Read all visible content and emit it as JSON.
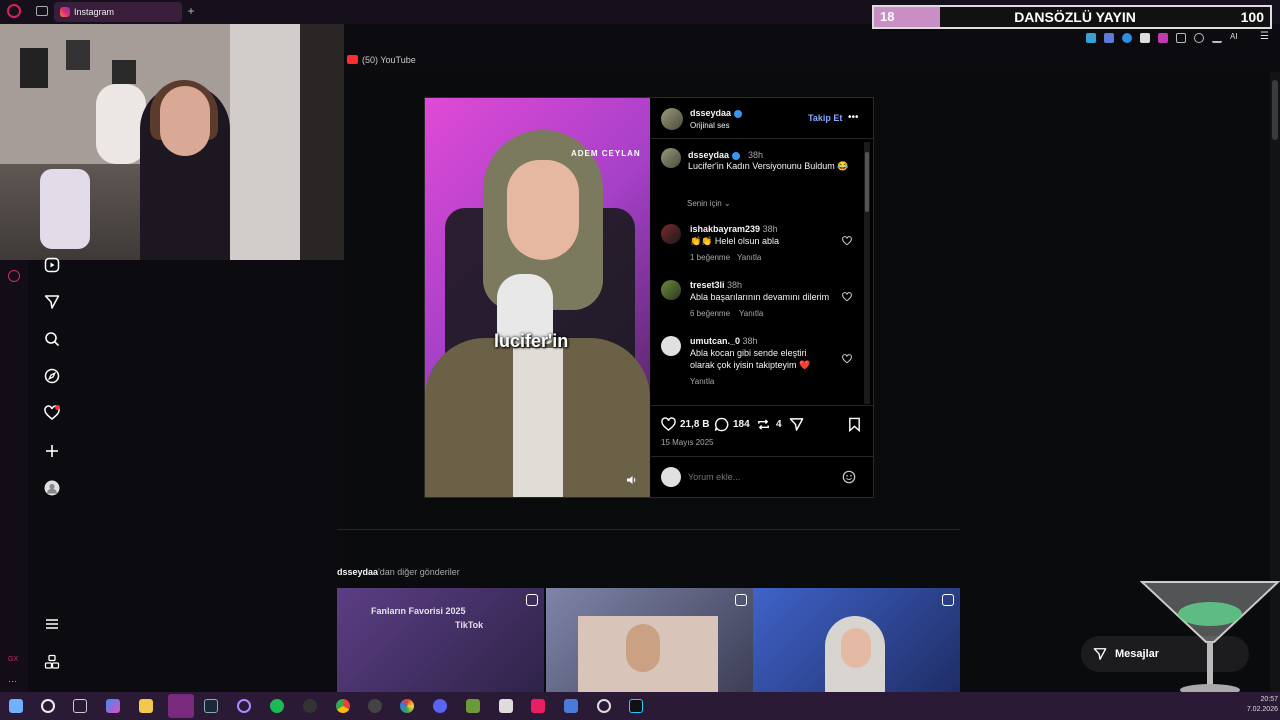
{
  "browser": {
    "active_tab_label": "Instagram",
    "new_tab_glyph": "+",
    "media_indicator": "(50) YouTube"
  },
  "overlay": {
    "counter_left": "18",
    "title": "DANSÖZLÜ YAYIN",
    "counter_right": "100",
    "ext_ai_label": "AI"
  },
  "post": {
    "username": "dsseydaa",
    "audio": "Orijinal ses",
    "follow_label": "Takip Et",
    "more_glyph": "•••",
    "video_brand": "ADEM CEYLAN",
    "video_caption": "lucifer'in",
    "caption": {
      "username": "dsseydaa",
      "time": "38h",
      "text": "Lucifer'in Kadın Versiyonunu Buldum 😂"
    },
    "for_you_label": "Senin için",
    "comments": [
      {
        "username": "ishakbayram239",
        "time": "38h",
        "text": "👏👏 Helel olsun abla",
        "likes": "1 beğenme",
        "reply": "Yanıtla"
      },
      {
        "username": "treset3li",
        "time": "38h",
        "text": "Abla başarılarının devamını dilerim",
        "likes": "6 beğenme",
        "reply": "Yanıtla"
      },
      {
        "username": "umutcan._0",
        "time": "38h",
        "text": "Abla kocan gibi sende eleştiri olarak çok iyisin takipteyim ❤️",
        "likes": "",
        "reply": "Yanıtla"
      }
    ],
    "like_count": "21,8 B",
    "comment_count": "184",
    "repost_count": "4",
    "date": "15 Mayıs 2025",
    "comment_placeholder": "Yorum ekle..."
  },
  "more_posts": {
    "username": "dsseydaa",
    "suffix": "'dan diğer gönderiler",
    "thumb1_text_a": "Fanların Favorisi 2025",
    "thumb1_text_b": "TikTok"
  },
  "messages_label": "Mesajlar",
  "taskbar": {
    "time": "20:57",
    "date": "7.02.2026"
  },
  "colors": {
    "accent_link": "#85a9ff",
    "verified": "#3897f0",
    "overlay_pink": "#c98fc5"
  },
  "icons": [
    "home-icon",
    "reels-icon",
    "send-icon",
    "search-icon",
    "explore-icon",
    "heart-icon",
    "create-icon",
    "profile-icon",
    "menu-icon",
    "more-apps-icon"
  ]
}
